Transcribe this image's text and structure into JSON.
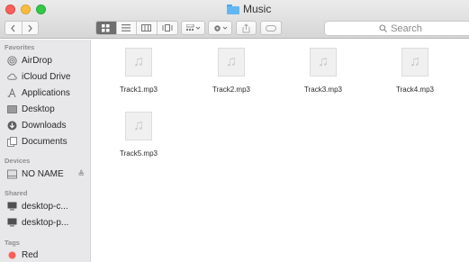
{
  "window": {
    "title": "Music"
  },
  "toolbar": {
    "back_icon": "chevron-left-icon",
    "forward_icon": "chevron-right-icon",
    "view_icons_icon": "grid-icon",
    "view_list_icon": "list-icon",
    "view_columns_icon": "columns-icon",
    "view_cover_icon": "cover-flow-icon",
    "arrange_icon": "arrange-icon",
    "action_icon": "gear-icon",
    "share_icon": "share-icon",
    "tags_icon": "tag-icon",
    "search_placeholder": "Search"
  },
  "sidebar": {
    "favorites_header": "Favorites",
    "favorites": [
      {
        "label": "AirDrop",
        "icon": "airdrop-icon"
      },
      {
        "label": "iCloud Drive",
        "icon": "cloud-icon"
      },
      {
        "label": "Applications",
        "icon": "applications-icon"
      },
      {
        "label": "Desktop",
        "icon": "desktop-icon"
      },
      {
        "label": "Downloads",
        "icon": "download-icon"
      },
      {
        "label": "Documents",
        "icon": "documents-icon"
      }
    ],
    "devices_header": "Devices",
    "devices": [
      {
        "label": "NO NAME",
        "icon": "drive-icon",
        "eject": "≜"
      }
    ],
    "shared_header": "Shared",
    "shared": [
      {
        "label": "desktop-c...",
        "icon": "computer-icon"
      },
      {
        "label": "desktop-p...",
        "icon": "computer-icon"
      }
    ],
    "tags_header": "Tags",
    "tags": [
      {
        "label": "Red",
        "color": "#ff5f57"
      }
    ]
  },
  "files": [
    {
      "name": "Track1.mp3",
      "icon": "music-file-icon"
    },
    {
      "name": "Track2.mp3",
      "icon": "music-file-icon"
    },
    {
      "name": "Track3.mp3",
      "icon": "music-file-icon"
    },
    {
      "name": "Track4.mp3",
      "icon": "music-file-icon"
    },
    {
      "name": "Track5.mp3",
      "icon": "music-file-icon"
    }
  ],
  "colors": {
    "background": "#f7cdc7",
    "sidebar": "#e8e7e9",
    "folder_blue": "#62b7f2"
  }
}
